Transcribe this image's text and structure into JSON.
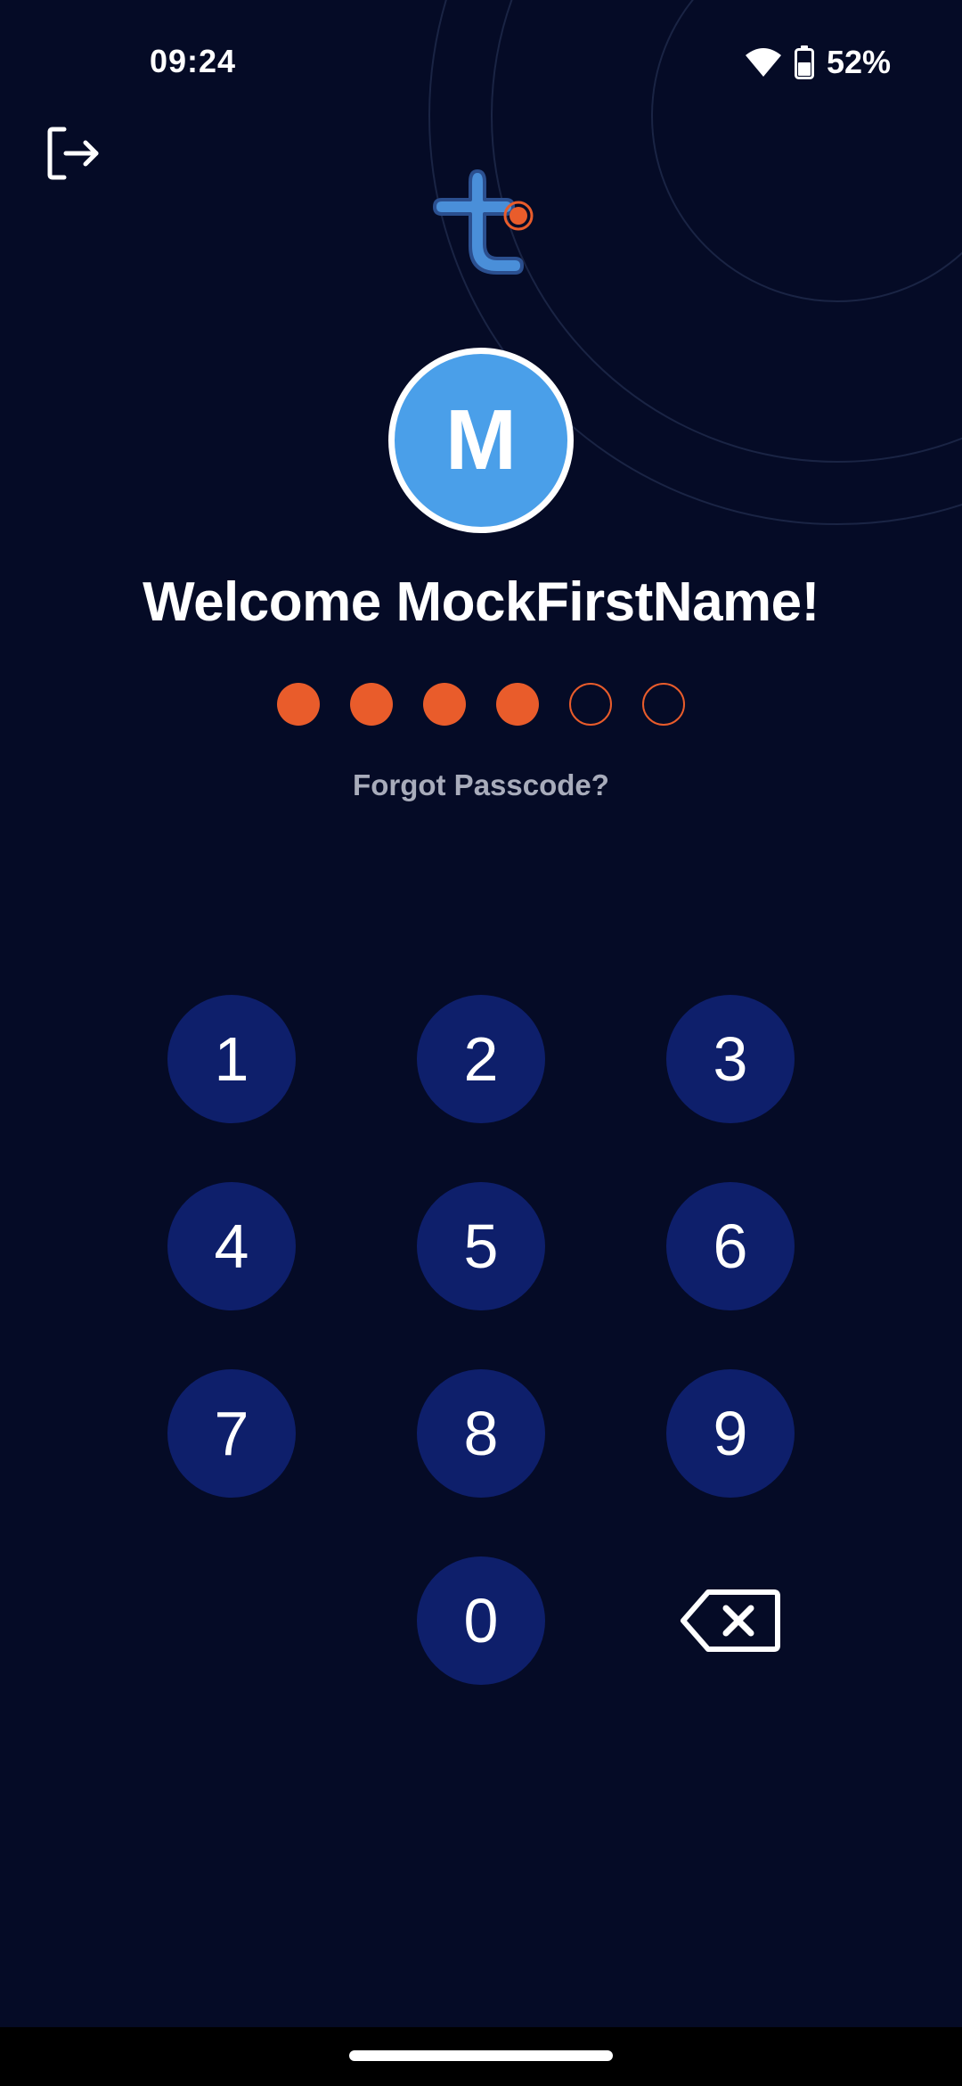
{
  "status_bar": {
    "time": "09:24",
    "battery_percent": "52%",
    "wifi_icon": "wifi-icon",
    "battery_icon": "battery-icon"
  },
  "header": {
    "logout_icon": "logout-icon",
    "logo": "brand-logo"
  },
  "profile": {
    "avatar_initial": "M",
    "avatar_color": "#4a9fe9",
    "welcome_text": "Welcome MockFirstName!"
  },
  "passcode": {
    "total_digits": 6,
    "entered_digits": 4,
    "dot_color": "#e95c2b",
    "forgot_label": "Forgot Passcode?"
  },
  "keypad": {
    "keys": [
      "1",
      "2",
      "3",
      "4",
      "5",
      "6",
      "7",
      "8",
      "9",
      "0"
    ],
    "backspace_icon": "backspace-icon",
    "key_color": "#0e1f6b"
  },
  "colors": {
    "background": "#050b26",
    "accent": "#e95c2b",
    "primary": "#4a9fe9"
  }
}
